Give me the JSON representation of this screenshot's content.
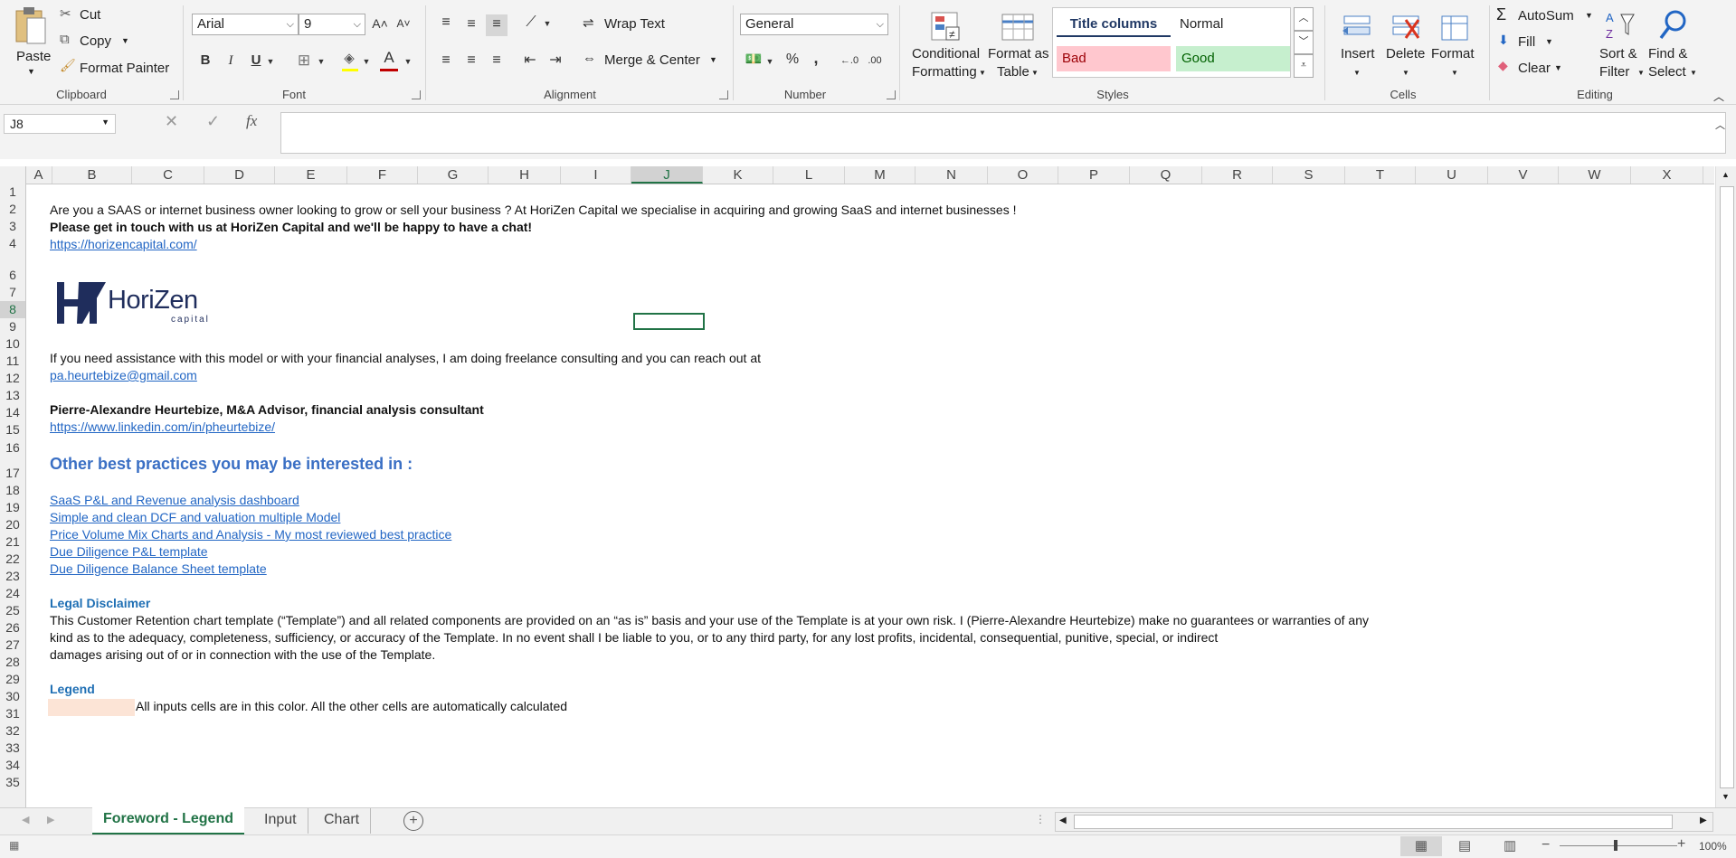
{
  "clipboard": {
    "paste": "Paste",
    "cut": "Cut",
    "copy": "Copy",
    "format_painter": "Format Painter",
    "group": "Clipboard"
  },
  "font": {
    "name": "Arial",
    "size": "9",
    "bold": "B",
    "italic": "I",
    "underline": "U",
    "group": "Font"
  },
  "alignment": {
    "wrap": "Wrap Text",
    "merge": "Merge & Center",
    "group": "Alignment"
  },
  "number": {
    "format": "General",
    "percent": "%",
    "comma": ",",
    "group": "Number"
  },
  "styles": {
    "conditional": [
      "Conditional",
      "Formatting"
    ],
    "format_table": [
      "Format as",
      "Table"
    ],
    "title_columns": "Title columns",
    "normal": "Normal",
    "bad": "Bad",
    "good": "Good",
    "group": "Styles"
  },
  "cells": {
    "insert": "Insert",
    "delete": "Delete",
    "format": "Format",
    "group": "Cells"
  },
  "editing": {
    "autosum": "AutoSum",
    "fill": "Fill",
    "clear": "Clear",
    "sort": [
      "Sort &",
      "Filter"
    ],
    "find": [
      "Find &",
      "Select"
    ],
    "group": "Editing"
  },
  "formula_bar": {
    "name_box": "J8",
    "fx": "fx",
    "value": ""
  },
  "columns": [
    "A",
    "B",
    "C",
    "D",
    "E",
    "F",
    "G",
    "H",
    "I",
    "J",
    "K",
    "L",
    "M",
    "N",
    "O",
    "P",
    "Q",
    "R",
    "S",
    "T",
    "U",
    "V",
    "W",
    "X"
  ],
  "rows": [
    "1",
    "2",
    "3",
    "4",
    "6",
    "7",
    "8",
    "9",
    "10",
    "11",
    "12",
    "13",
    "14",
    "15",
    "16",
    "17",
    "18",
    "19",
    "20",
    "21",
    "22",
    "23",
    "24",
    "25",
    "26",
    "27",
    "28",
    "29",
    "30",
    "31",
    "32",
    "33",
    "34",
    "35"
  ],
  "sheet": {
    "r2": "Are you a SAAS or internet business owner looking to grow or sell your business ? At HoriZen Capital we specialise in acquiring and growing SaaS and internet businesses !",
    "r3": "Please get in touch with us at HoriZen Capital and we'll be happy to have a chat!",
    "r4": "https://horizencapital.com/",
    "logo_word": "HoriZen",
    "logo_sub": "capital",
    "r10": "If you need assistance with this model or with your financial analyses, I am doing freelance consulting and you can reach out at",
    "r11": "pa.heurtebize@gmail.com",
    "r13": "Pierre-Alexandre Heurtebize, M&A Advisor, financial analysis consultant",
    "r14": "https://www.linkedin.com/in/pheurtebize/",
    "r16": "Other best practices you may be interested in :",
    "r18": "SaaS P&L and Revenue analysis dashboard",
    "r19": "Simple and clean DCF and valuation multiple Model",
    "r20": "Price Volume Mix Charts and Analysis - My most reviewed best practice",
    "r21": "Due Diligence P&L template",
    "r22": "Due Diligence Balance Sheet template",
    "r24": "Legal Disclaimer",
    "r25": "This Customer Retention chart template (“Template”) and all related components are provided on an “as is” basis and your use of the Template is at your own risk.  I (Pierre-Alexandre Heurtebize) make no guarantees or warranties of any",
    "r26": "kind as to the adequacy, completeness, sufficiency, or accuracy of the Template. In no event shall I be liable to you, or to any third party, for any lost profits, incidental, consequential, punitive, special, or indirect",
    "r27": "damages arising out of or in connection with the use of the Template.",
    "r29": "Legend",
    "r30": "All inputs cells are in this color. All the other cells are automatically calculated"
  },
  "tabs": {
    "active": "Foreword - Legend",
    "t2": "Input",
    "t3": "Chart"
  },
  "status": {
    "zoom": "100%"
  },
  "colors": {
    "accent_green": "#217346",
    "link_blue": "#2266c4",
    "heading_blue": "#3a6fc4",
    "input_fill": "#fce4d6",
    "bad_fill": "#ffc7ce",
    "good_fill": "#c6efce"
  }
}
